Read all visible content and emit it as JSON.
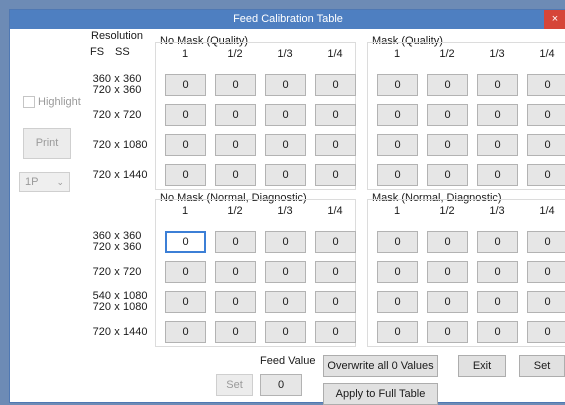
{
  "window": {
    "title": "Feed Calibration Table",
    "close_label": "×"
  },
  "left_panel": {
    "highlight_label": "Highlight",
    "print_label": "Print",
    "select_value": "1P"
  },
  "columns": {
    "resolution": "Resolution",
    "fs": "FS",
    "ss": "SS",
    "times": "x"
  },
  "fractions": [
    "1",
    "1/2",
    "1/3",
    "1/4"
  ],
  "top_rows": [
    {
      "lines": [
        {
          "fs": "360",
          "ss": "360"
        },
        {
          "fs": "720",
          "ss": "360"
        }
      ]
    },
    {
      "lines": [
        {
          "fs": "720",
          "ss": "720"
        }
      ]
    },
    {
      "lines": [
        {
          "fs": "720",
          "ss": "1080"
        }
      ]
    },
    {
      "lines": [
        {
          "fs": "720",
          "ss": "1440"
        }
      ]
    }
  ],
  "bottom_rows": [
    {
      "lines": [
        {
          "fs": "360",
          "ss": "360"
        },
        {
          "fs": "720",
          "ss": "360"
        }
      ]
    },
    {
      "lines": [
        {
          "fs": "720",
          "ss": "720"
        }
      ]
    },
    {
      "lines": [
        {
          "fs": "540",
          "ss": "1080"
        },
        {
          "fs": "720",
          "ss": "1080"
        }
      ]
    },
    {
      "lines": [
        {
          "fs": "720",
          "ss": "1440"
        }
      ]
    }
  ],
  "groups": {
    "no_mask_quality": {
      "title": "No Mask (Quality)",
      "values": [
        [
          "0",
          "0",
          "0",
          "0"
        ],
        [
          "0",
          "0",
          "0",
          "0"
        ],
        [
          "0",
          "0",
          "0",
          "0"
        ],
        [
          "0",
          "0",
          "0",
          "0"
        ]
      ]
    },
    "mask_quality": {
      "title": "Mask (Quality)",
      "values": [
        [
          "0",
          "0",
          "0",
          "0"
        ],
        [
          "0",
          "0",
          "0",
          "0"
        ],
        [
          "0",
          "0",
          "0",
          "0"
        ],
        [
          "0",
          "0",
          "0",
          "0"
        ]
      ]
    },
    "no_mask_normal": {
      "title": "No Mask (Normal, Diagnostic)",
      "values": [
        [
          "0",
          "0",
          "0",
          "0"
        ],
        [
          "0",
          "0",
          "0",
          "0"
        ],
        [
          "0",
          "0",
          "0",
          "0"
        ],
        [
          "0",
          "0",
          "0",
          "0"
        ]
      ]
    },
    "mask_normal": {
      "title": "Mask (Normal, Diagnostic)",
      "values": [
        [
          "0",
          "0",
          "0",
          "0"
        ],
        [
          "0",
          "0",
          "0",
          "0"
        ],
        [
          "0",
          "0",
          "0",
          "0"
        ],
        [
          "0",
          "0",
          "0",
          "0"
        ]
      ]
    }
  },
  "footer": {
    "feed_value_label": "Feed Value",
    "feed_value": "0",
    "set_small_label": "Set",
    "overwrite_label": "Overwrite all 0 Values",
    "apply_label": "Apply to Full Table",
    "exit_label": "Exit",
    "set_label": "Set"
  }
}
